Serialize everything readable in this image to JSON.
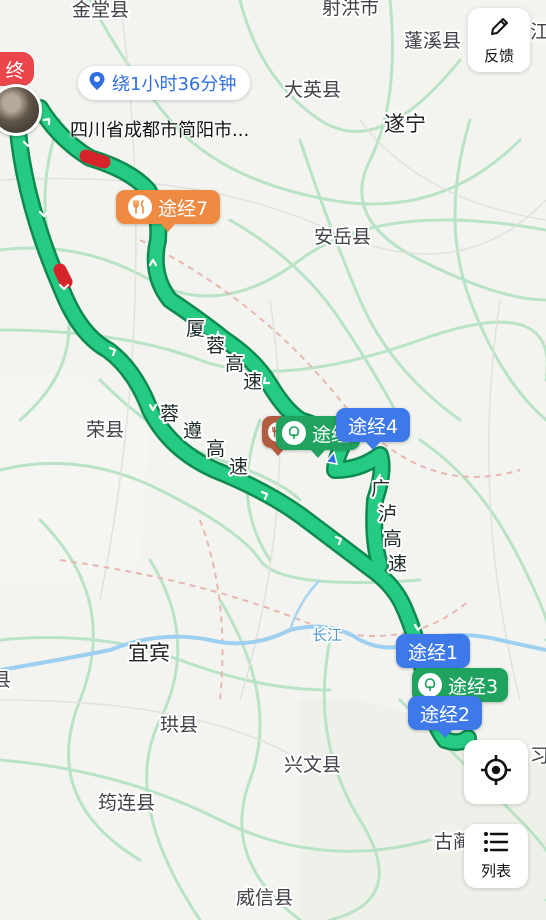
{
  "route": {
    "detour_label": "绕1小时36分钟",
    "destination_name": "四川省成都市简阳市..."
  },
  "end_marker": "终",
  "waypoints": {
    "w7": "途经7",
    "w4": "途经4",
    "w4_partial": "途经",
    "w1": "途经1",
    "w3": "途经3",
    "w2": "途经2"
  },
  "highways": {
    "xiarong": [
      "厦",
      "蓉",
      "高",
      "速"
    ],
    "rongzun": [
      "蓉",
      "遵",
      "高",
      "速"
    ],
    "guanglu": [
      "广",
      "泸",
      "高",
      "速"
    ]
  },
  "places": {
    "jintang": "金堂县",
    "shehong": "射洪市",
    "pengxi": "蓬溪县",
    "daying": "大英县",
    "suining": "遂宁",
    "anyue": "安岳县",
    "rong": "荣县",
    "yibin": "宜宾",
    "gong": "珙县",
    "xingwen": "兴文县",
    "junlian": "筠连县",
    "weixin": "威信县",
    "gulin_partial": "古蔺",
    "left_edge_county": "县",
    "right_edge_top": "江",
    "right_edge_mid": "习"
  },
  "river": "长江",
  "controls": {
    "feedback_label": "反馈",
    "list_label": "列表"
  },
  "colors": {
    "route_green": "#1fc47a",
    "route_border": "#0f8a4f",
    "congestion_red": "#d6242a",
    "waypoint_blue": "#3d79e8",
    "waypoint_orange": "#ef8a43",
    "waypoint_green": "#20a35f"
  },
  "icons": {
    "feedback": "edit-pencil-icon",
    "locate": "crosshair-locate-icon",
    "list": "list-icon",
    "location": "location-pin-icon",
    "restaurant": "fork-knife-icon",
    "service_area": "tree-icon"
  }
}
